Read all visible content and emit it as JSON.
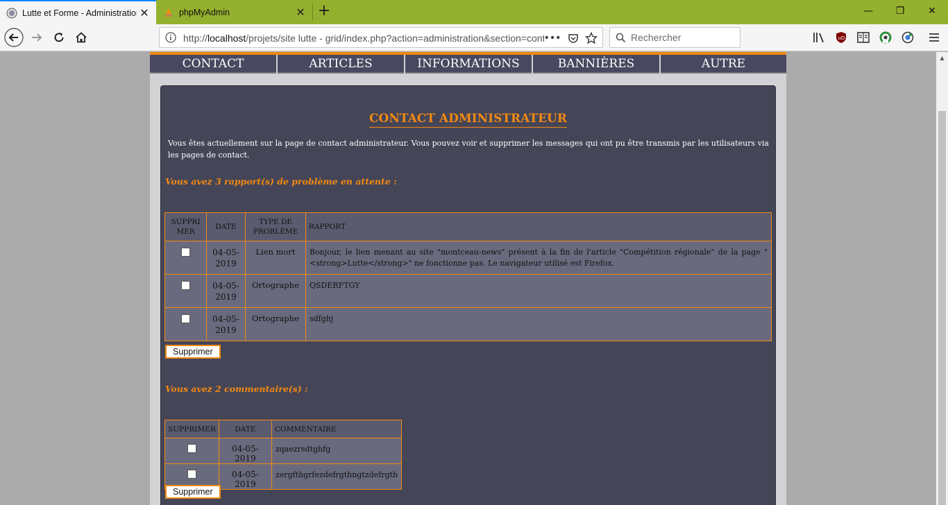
{
  "browser": {
    "tabs": [
      {
        "title": "Lutte et Forme - Administration",
        "active": true
      },
      {
        "title": "phpMyAdmin",
        "active": false
      }
    ],
    "url_prefix": "http://",
    "url_host": "localhost",
    "url_rest": "/projets/site lutte - grid/index.php?action=administration&section=contact",
    "search_placeholder": "Rechercher",
    "accent_color": "#94b02e"
  },
  "menu": {
    "items": [
      "CONTACT",
      "ARTICLES",
      "INFORMATIONS",
      "BANNIÈRES",
      "AUTRE"
    ]
  },
  "panel": {
    "title": "CONTACT ADMINISTRATEUR",
    "intro": "Vous êtes actuellement sur la page de contact administrateur. Vous pouvez voir et supprimer les messages qui ont pu être transmis par les utilisateurs via les pages de contact."
  },
  "reports": {
    "heading": "Vous avez 3 rapport(s) de problème en attente :",
    "columns": [
      "SUPPRI MER",
      "DATE",
      "TYPE DE PROBLÈME",
      "RAPPORT"
    ],
    "rows": [
      {
        "date": "04-05-2019",
        "type": "Lien mort",
        "text": "Bonjour, le lien menant au site \"montceau-news\" présent à la fin de l'article \"Compétition régionale\" de la page \"<strong>Lutte</strong>\" ne fonctionne pas. Le navigateur utilisé est Firefox."
      },
      {
        "date": "04-05-2019",
        "type": "Ortographe",
        "text": "QSDERFTGY"
      },
      {
        "date": "04-05-2019",
        "type": "Ortographe",
        "text": "sdfghj"
      }
    ],
    "button": "Supprimer"
  },
  "comments": {
    "heading": "Vous avez 2 commentaire(s) :",
    "columns": [
      "SUPPRIMER",
      "DATE",
      "COMMENTAIRE"
    ],
    "rows": [
      {
        "date": "04-05-2019",
        "text": "zqaezrsdtghfg"
      },
      {
        "date": "04-05-2019",
        "text": "zergfthgrfezdefrgthngtzdefrgth"
      }
    ],
    "button": "Supprimer"
  },
  "colors": {
    "orange": "#f28a12",
    "panel": "#454558",
    "menu": "#484860"
  }
}
